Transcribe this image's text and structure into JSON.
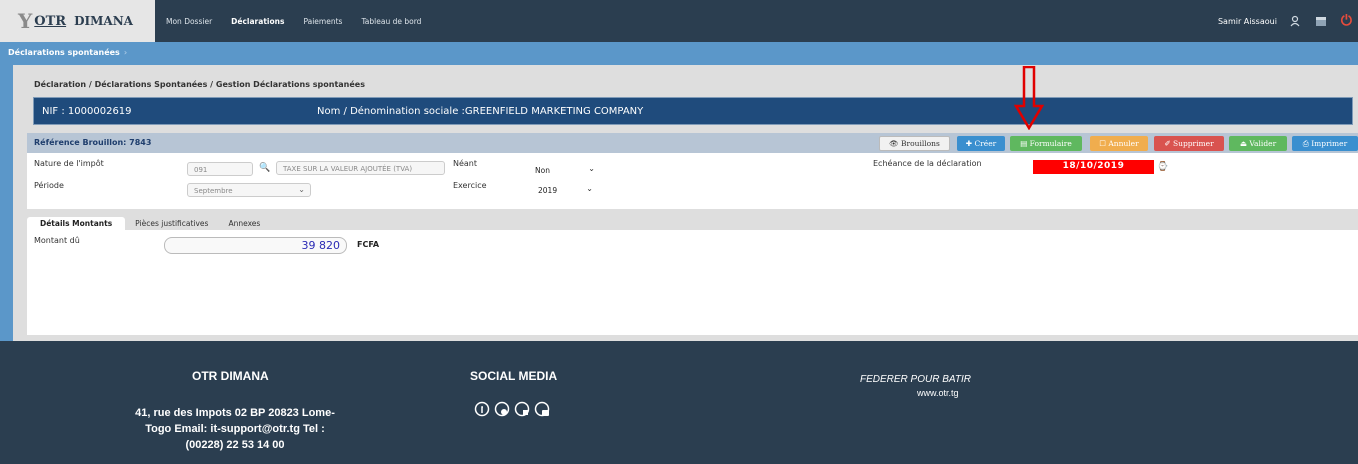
{
  "app": {
    "logo_otr": "OTR",
    "logo_dimana": "DIMANA"
  },
  "nav": {
    "items": [
      "Mon Dossier",
      "Déclarations",
      "Paiements",
      "Tableau de bord"
    ],
    "user_name": "Samir  Aissaoui"
  },
  "subbar": {
    "title": "Déclarations spontanées",
    "separator": "›"
  },
  "breadcrumb": {
    "part1": "Déclaration",
    "part2": "Déclarations Spontanées",
    "part3": "Gestion Déclarations spontanées"
  },
  "nif_bar": {
    "nif": "NIF : 1000002619",
    "company": "Nom / Dénomination sociale :GREENFIELD MARKETING COMPANY"
  },
  "reference": {
    "label": "Référence Brouillon: 7843"
  },
  "toolbar": {
    "brouillons": "Brouillons",
    "creer": "Créer",
    "formulaire": "Formulaire",
    "annuler": "Annuler",
    "supprimer": "Supprimer",
    "valider": "Valider",
    "imprimer": "Imprimer"
  },
  "form": {
    "nature_label": "Nature de l'impôt",
    "nature_code": "091",
    "nature_desc": "TAXE SUR LA VALEUR AJOUTÉE (TVA)",
    "neant_label": "Néant",
    "neant_value": "Non",
    "echeance_label": "Echéance de la déclaration",
    "echeance_value": "18/10/2019",
    "periode_label": "Période",
    "periode_value": "Septembre",
    "exercice_label": "Exercice",
    "exercice_value": "2019"
  },
  "tabs": [
    "Détails Montants",
    "Pièces justificatives",
    "Annexes"
  ],
  "montant": {
    "label": "Montant dû",
    "value": "39 820",
    "currency": "FCFA"
  },
  "footer": {
    "title": "OTR DIMANA",
    "address_line1": "41, rue des Impots 02 BP 20823 Lome-",
    "address_line2": "Togo Email: it-support@otr.tg Tel :",
    "address_line3": "(00228) 22 53 14 00",
    "social_title": "SOCIAL MEDIA",
    "slogan": "FEDERER POUR BATIR",
    "url": "www.otr.tg"
  },
  "colors": {
    "navbar": "#2b3e50",
    "subbar": "#5b97c9",
    "nif_bar": "#1f4b7c",
    "echeance": "#ff0000",
    "annotation_arrow": "#e00000"
  }
}
